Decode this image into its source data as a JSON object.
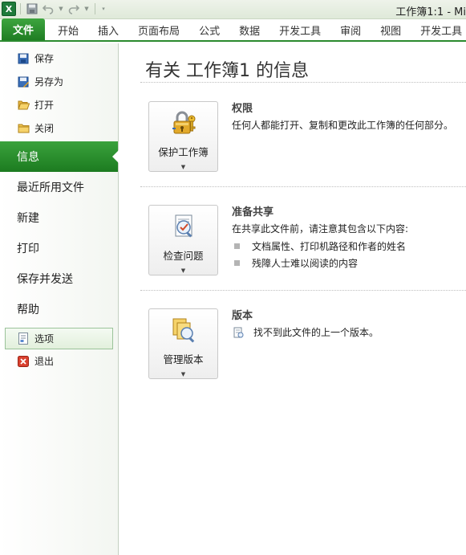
{
  "titlebar": {
    "app_logo": "X",
    "window_title": "工作簿1:1  -  Mi"
  },
  "ribbon": {
    "tabs": [
      "文件",
      "开始",
      "插入",
      "页面布局",
      "公式",
      "数据",
      "开发工具",
      "审阅",
      "视图",
      "开发工具"
    ]
  },
  "sidebar": {
    "top_items": [
      {
        "label": "保存",
        "icon": "save-icon"
      },
      {
        "label": "另存为",
        "icon": "save-as-icon"
      },
      {
        "label": "打开",
        "icon": "open-folder-icon"
      },
      {
        "label": "关闭",
        "icon": "close-folder-icon"
      }
    ],
    "big_items": [
      "信息",
      "最近所用文件",
      "新建",
      "打印",
      "保存并发送",
      "帮助"
    ],
    "bottom_items": [
      {
        "label": "选项",
        "icon": "options-icon"
      },
      {
        "label": "退出",
        "icon": "exit-icon"
      }
    ]
  },
  "main": {
    "title": "有关 工作簿1 的信息",
    "permissions": {
      "button_label": "保护工作簿",
      "heading": "权限",
      "text": "任何人都能打开、复制和更改此工作簿的任何部分。"
    },
    "prepare": {
      "button_label": "检查问题",
      "heading": "准备共享",
      "text": "在共享此文件前，请注意其包含以下内容:",
      "bullets": [
        "文档属性、打印机路径和作者的姓名",
        "残障人士难以阅读的内容"
      ]
    },
    "versions": {
      "button_label": "管理版本",
      "heading": "版本",
      "text": "找不到此文件的上一个版本。"
    }
  },
  "colors": {
    "accent_green": "#1f7d23",
    "file_tab_green": "#3da53f"
  }
}
